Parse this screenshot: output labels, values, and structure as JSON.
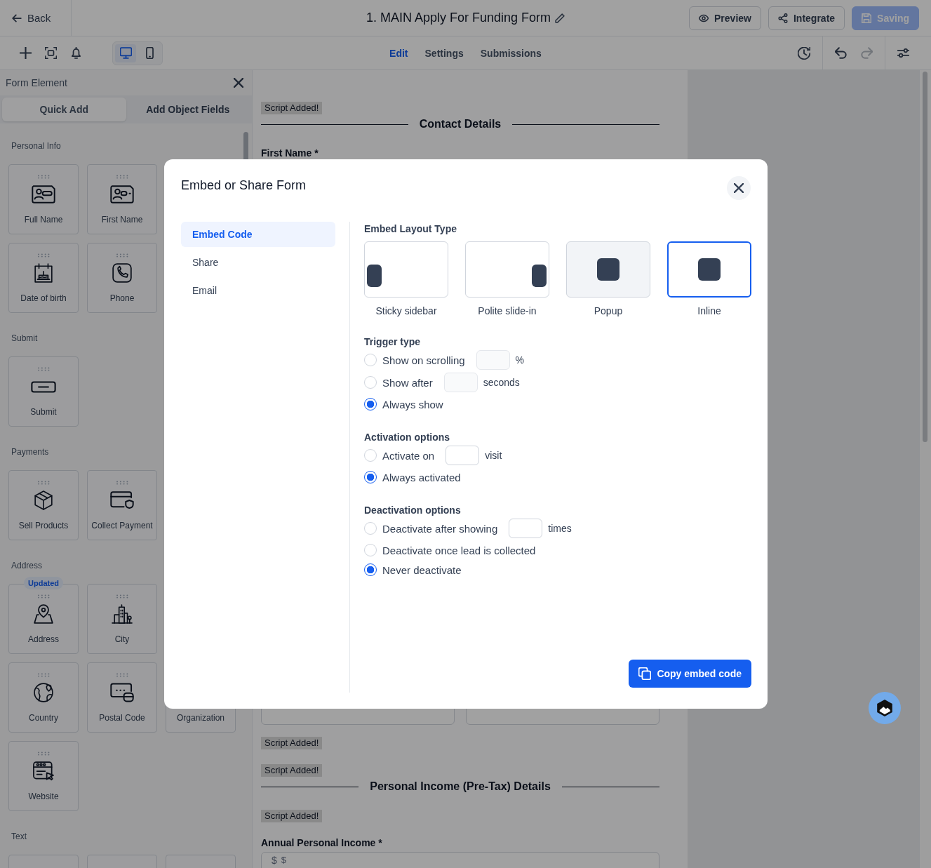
{
  "topbar": {
    "back_label": "Back",
    "title": "1. MAIN Apply For Funding Form",
    "actions": [
      {
        "kind": "preview",
        "label": "Preview",
        "busy": false
      },
      {
        "kind": "integrate",
        "label": "Integrate",
        "busy": false
      },
      {
        "kind": "save",
        "label": "Saving",
        "busy": true
      }
    ]
  },
  "toolbar": {
    "device_toggle": [
      {
        "kind": "desktop",
        "selected": true
      },
      {
        "kind": "mobile",
        "selected": false
      }
    ],
    "tabs": [
      {
        "label": "Edit",
        "selected": true
      },
      {
        "label": "Settings",
        "selected": false
      },
      {
        "label": "Submissions",
        "selected": false
      }
    ],
    "undo": {
      "disabled": false
    },
    "redo": {
      "disabled": true
    }
  },
  "sidebar": {
    "title": "Form Element",
    "tabs": [
      {
        "label": "Quick Add",
        "selected": true
      },
      {
        "label": "Add Object Fields",
        "selected": false
      }
    ],
    "sections": [
      {
        "title": "Personal Info",
        "rows": [
          [
            {
              "label": "Full Name",
              "kind": "full-name"
            },
            {
              "label": "First Name",
              "kind": "first-name"
            }
          ],
          [
            {
              "label": "Date of birth",
              "kind": "birthday"
            },
            {
              "label": "Phone",
              "kind": "phone"
            }
          ]
        ]
      },
      {
        "title": "Submit",
        "rows": [
          [
            {
              "label": "Submit",
              "kind": "submit"
            }
          ]
        ]
      },
      {
        "title": "Payments",
        "rows": [
          [
            {
              "label": "Sell Products",
              "kind": "products"
            },
            {
              "label": "Collect Payment",
              "kind": "payment"
            }
          ]
        ]
      },
      {
        "title": "Address",
        "rows": [
          [
            {
              "label": "Address",
              "kind": "address",
              "badge": "Updated"
            },
            {
              "label": "City",
              "kind": "city"
            }
          ],
          [
            {
              "label": "Country",
              "kind": "country"
            },
            {
              "label": "Postal Code",
              "kind": "postal"
            },
            {
              "label": "Organization",
              "kind": "covered"
            }
          ],
          [
            {
              "label": "Website",
              "kind": "website"
            }
          ]
        ]
      },
      {
        "title": "Text",
        "rows": [
          [
            {
              "kind": "covered"
            },
            {
              "kind": "covered"
            },
            {
              "kind": "covered"
            }
          ]
        ]
      }
    ]
  },
  "canvas": {
    "blocks_above": [
      {
        "kind": "script_tag",
        "text": "Script Added!"
      },
      {
        "kind": "section_header",
        "text": "Contact Details"
      },
      {
        "kind": "field_label",
        "text": "First Name *"
      }
    ],
    "blocks_below": [
      {
        "kind": "field_row",
        "fields": [
          {
            "kind": "text"
          },
          {
            "kind": "text"
          }
        ]
      },
      {
        "kind": "script_tag",
        "text": "Script Added!"
      },
      {
        "kind": "script_tag",
        "text": "Script Added!"
      },
      {
        "kind": "section_header",
        "text": "Personal Income (Pre-Tax) Details"
      },
      {
        "kind": "script_tag",
        "text": "Script Added!"
      },
      {
        "kind": "field_label",
        "text": "Annual Personal Income *"
      },
      {
        "kind": "currency_field",
        "prefix": "$",
        "placeholder": "$"
      }
    ]
  },
  "dialog": {
    "title": "Embed or Share Form",
    "nav": [
      {
        "label": "Embed Code",
        "selected": true
      },
      {
        "label": "Share",
        "selected": false
      },
      {
        "label": "Email",
        "selected": false
      }
    ],
    "layout_type": {
      "label": "Embed Layout Type",
      "options": [
        {
          "kind": "sticky-sidebar",
          "label": "Sticky sidebar",
          "selected": false,
          "hovered": false
        },
        {
          "kind": "slide-in",
          "label": "Polite slide-in",
          "selected": false,
          "hovered": false
        },
        {
          "kind": "popup",
          "label": "Popup",
          "selected": false,
          "hovered": true
        },
        {
          "kind": "inline",
          "label": "Inline",
          "selected": true,
          "hovered": false
        }
      ]
    },
    "option_groups": [
      {
        "title": "Trigger type",
        "options": [
          {
            "label": "Show on scrolling",
            "selected": false,
            "input": {
              "disabled": true
            },
            "suffix": "%"
          },
          {
            "label": "Show after",
            "selected": false,
            "input": {
              "disabled": true
            },
            "suffix": "seconds"
          },
          {
            "label": "Always show",
            "selected": true
          }
        ]
      },
      {
        "title": "Activation options",
        "options": [
          {
            "label": "Activate on",
            "selected": false,
            "input": {
              "disabled": false
            },
            "suffix": "visit"
          },
          {
            "label": "Always activated",
            "selected": true
          }
        ]
      },
      {
        "title": "Deactivation options",
        "options": [
          {
            "label": "Deactivate after showing",
            "selected": false,
            "input": {
              "disabled": false
            },
            "suffix": "times"
          },
          {
            "label": "Deactivate once lead is collected",
            "selected": false
          },
          {
            "label": "Never deactivate",
            "selected": true
          }
        ]
      }
    ],
    "copy_button": {
      "label": "Copy embed code"
    }
  }
}
